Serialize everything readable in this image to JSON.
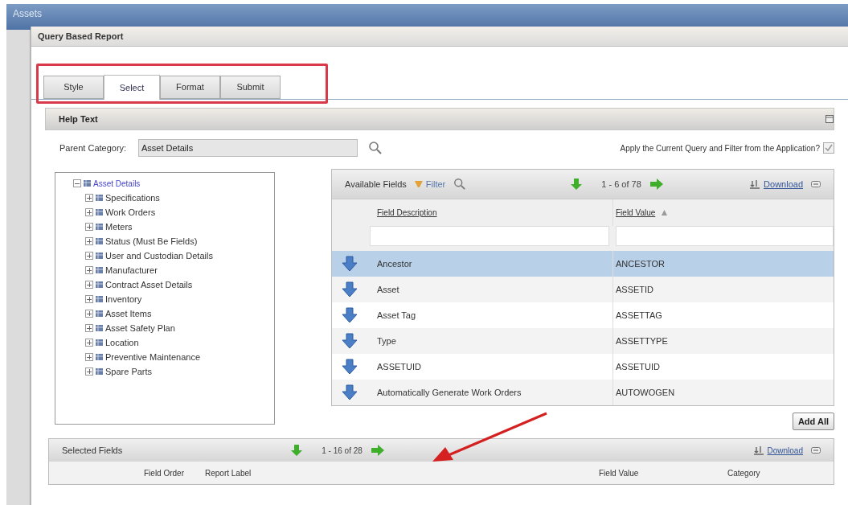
{
  "app_bar": {
    "title": "Assets"
  },
  "dialog": {
    "title": "Query Based Report"
  },
  "tabs": [
    {
      "label": "Style",
      "selected": false
    },
    {
      "label": "Select",
      "selected": true
    },
    {
      "label": "Format",
      "selected": false
    },
    {
      "label": "Submit",
      "selected": false
    }
  ],
  "help_bar": {
    "label": "Help Text"
  },
  "parent_category": {
    "label": "Parent Category:",
    "value": "Asset Details"
  },
  "apply_query": {
    "label": "Apply the Current Query and Filter from the Application?",
    "checked": true
  },
  "tree": [
    {
      "label": "Asset Details",
      "expanded": true,
      "children": [
        {
          "label": "Specifications",
          "expanded": false
        },
        {
          "label": "Work Orders",
          "expanded": false
        },
        {
          "label": "Meters",
          "expanded": false
        },
        {
          "label": "Status (Must Be Fields)",
          "expanded": false
        },
        {
          "label": "User and Custodian Details",
          "expanded": false
        },
        {
          "label": "Manufacturer",
          "expanded": false
        },
        {
          "label": "Contract Asset Details",
          "expanded": false
        },
        {
          "label": "Inventory",
          "expanded": false
        },
        {
          "label": "Asset Items",
          "expanded": false
        },
        {
          "label": "Asset Safety Plan",
          "expanded": false
        },
        {
          "label": "Location",
          "expanded": false
        },
        {
          "label": "Preventive Maintenance",
          "expanded": false
        },
        {
          "label": "Spare Parts",
          "expanded": false
        }
      ]
    }
  ],
  "available_fields": {
    "title": "Available Fields",
    "filter": "Filter",
    "paging": "1 - 6 of 78",
    "download": "Download",
    "columns": [
      "Field Description",
      "Field Value"
    ],
    "rows": [
      {
        "description": "Ancestor",
        "value": "ANCESTOR",
        "selected": true
      },
      {
        "description": "Asset",
        "value": "ASSETID",
        "selected": false
      },
      {
        "description": "Asset Tag",
        "value": "ASSETTAG",
        "selected": false
      },
      {
        "description": "Type",
        "value": "ASSETTYPE",
        "selected": false
      },
      {
        "description": "ASSETUID",
        "value": "ASSETUID",
        "selected": false
      },
      {
        "description": "Automatically Generate Work Orders",
        "value": "AUTOWOGEN",
        "selected": false
      }
    ]
  },
  "add_all": "Add All",
  "selected_fields": {
    "title": "Selected Fields",
    "paging": "1 - 16 of 28",
    "download": "Download",
    "columns": [
      "Field Order",
      "Report Label",
      "Field Value",
      "Category"
    ]
  }
}
